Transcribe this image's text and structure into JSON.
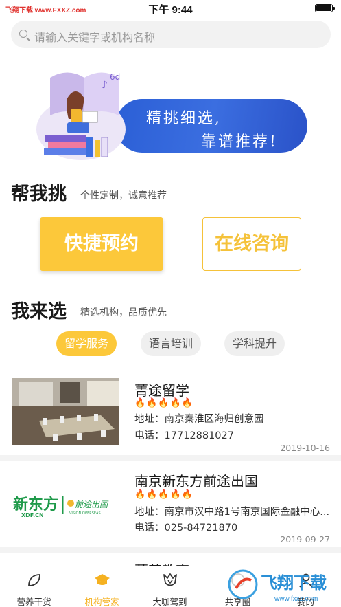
{
  "status_bar": {
    "carrier": "飞翔下载 www.FXXZ.com",
    "time": "下午 9:44"
  },
  "search": {
    "placeholder": "请输入关键字或机构名称"
  },
  "banner": {
    "line1": "精挑细选,",
    "line2": "靠谱推荐!"
  },
  "pick_section": {
    "title": "帮我挑",
    "subtitle": "个性定制，诚意推荐",
    "quick_button": "快捷预约",
    "consult_button": "在线咨询"
  },
  "choose_section": {
    "title": "我来选",
    "subtitle": "精选机构，品质优先",
    "tabs": [
      {
        "label": "留学服务",
        "active": true
      },
      {
        "label": "语言培训",
        "active": false
      },
      {
        "label": "学科提升",
        "active": false
      }
    ]
  },
  "institutions": [
    {
      "name": "菁途留学",
      "rating_icons": 5,
      "address": "地址：南京秦淮区海归创意园",
      "phone": "电话：17712881027",
      "date": "2019-10-16",
      "image": "meeting-room-photo"
    },
    {
      "name": "南京新东方前途出国",
      "rating_icons": 5,
      "address": "地址：南京市汉中路1号南京国际金融中心...",
      "phone": "电话：025-84721870",
      "date": "2019-09-27",
      "image": "new-oriental-logo",
      "logo_text": {
        "brand": "新东方",
        "domain": "XDF.CN",
        "sub": "前途出国",
        "sub_en": "VISION OVERSEAS"
      }
    },
    {
      "name": "菁英教育"
    }
  ],
  "tabbar": {
    "items": [
      {
        "label": "营养干货",
        "icon": "leaf-icon",
        "active": false
      },
      {
        "label": "机构管家",
        "icon": "graduation-cap-icon",
        "active": true
      },
      {
        "label": "大咖驾到",
        "icon": "crown-badge-icon",
        "active": false
      },
      {
        "label": "共享圈",
        "icon": "circle-icon",
        "active": false
      },
      {
        "label": "我的",
        "icon": "person-icon",
        "active": false
      }
    ]
  },
  "watermark": {
    "text": "飞翔下载",
    "url": "www.fxxz.com"
  },
  "colors": {
    "accent": "#fcc83a",
    "banner_blue": "#2f62d8",
    "flame": "#f5a623"
  }
}
